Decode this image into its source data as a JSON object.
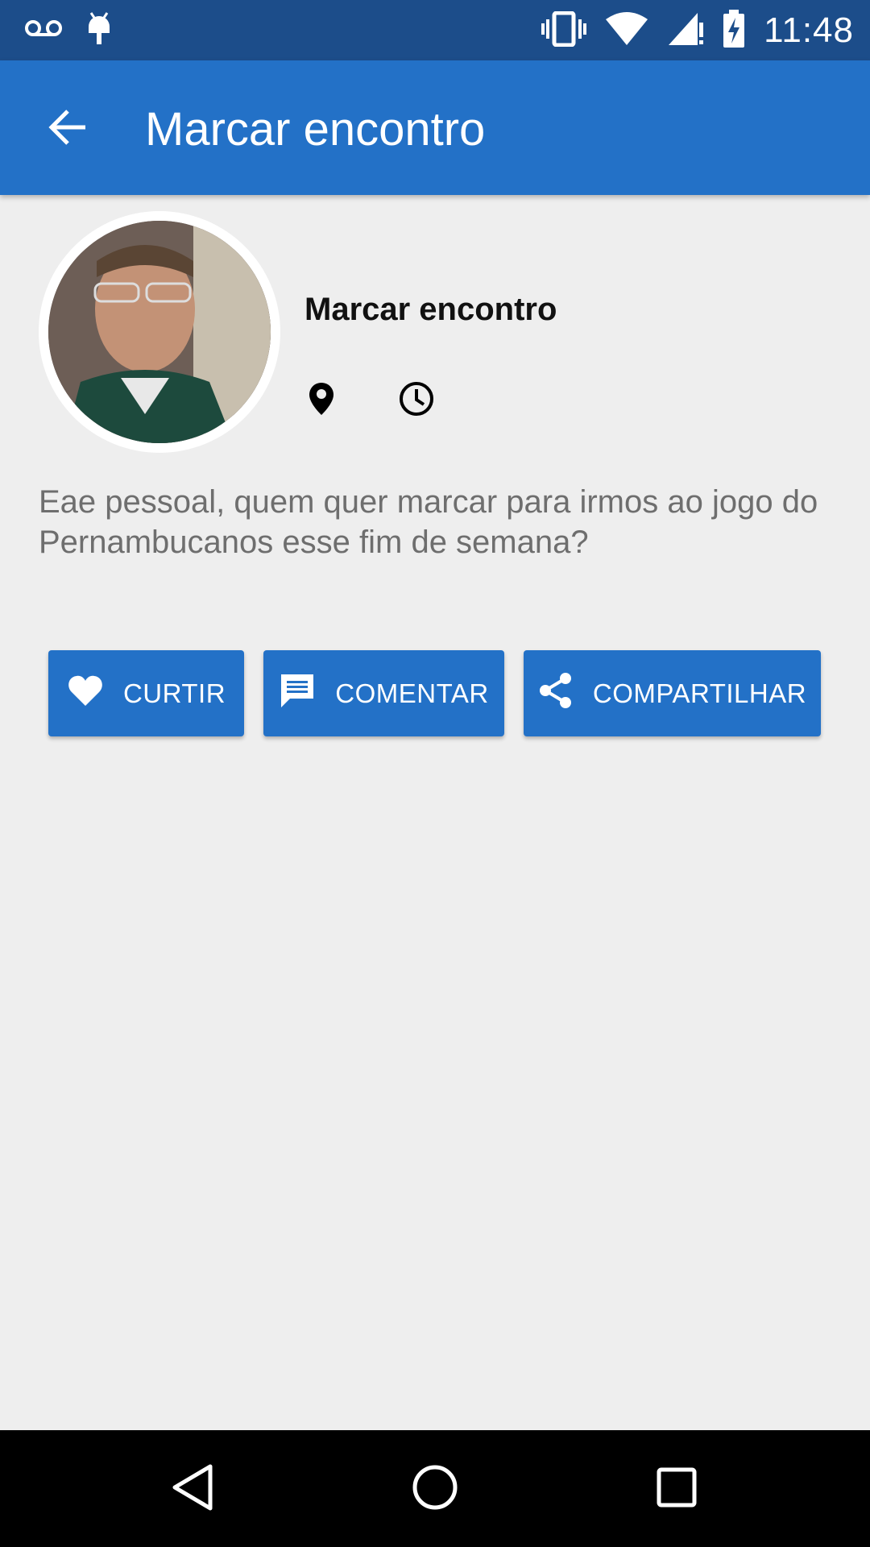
{
  "status_bar": {
    "time": "11:48",
    "icons": [
      "voicemail-icon",
      "android-debug-icon",
      "vibrate-icon",
      "wifi-icon",
      "signal-icon",
      "battery-charging-icon"
    ]
  },
  "app_bar": {
    "title": "Marcar encontro",
    "back_icon": "arrow-back-icon"
  },
  "post": {
    "title": "Marcar encontro",
    "meta_icons": [
      "location-pin-icon",
      "clock-icon"
    ],
    "description": "Eae pessoal, quem quer marcar para irmos ao jogo do Pernambucanos esse fim de semana?"
  },
  "actions": {
    "like": {
      "label": "CURTIR",
      "icon": "heart-icon"
    },
    "comment": {
      "label": "COMENTAR",
      "icon": "comment-icon"
    },
    "share": {
      "label": "COMPARTILHAR",
      "icon": "share-icon"
    }
  },
  "nav_bar": {
    "icons": [
      "back-triangle-icon",
      "home-circle-icon",
      "recents-square-icon"
    ]
  },
  "colors": {
    "status_bar": "#1c4d8a",
    "primary": "#2371c7",
    "background": "#eeeeee"
  }
}
